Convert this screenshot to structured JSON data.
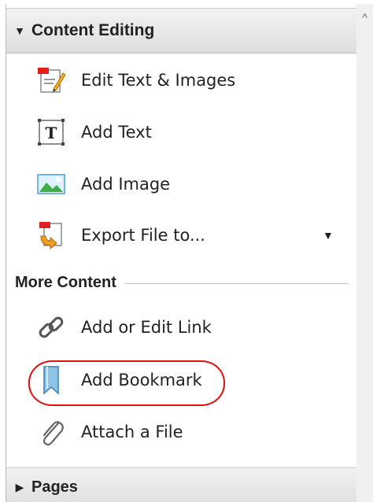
{
  "panel": {
    "content_editing": {
      "title": "Content Editing",
      "items": [
        {
          "label": "Edit Text & Images",
          "icon": "edit-text-images-icon"
        },
        {
          "label": "Add Text",
          "icon": "add-text-icon"
        },
        {
          "label": "Add Image",
          "icon": "add-image-icon"
        },
        {
          "label": "Export File to...",
          "icon": "export-file-icon",
          "has_dropdown": true
        }
      ]
    },
    "more_content": {
      "title": "More Content",
      "items": [
        {
          "label": "Add or Edit Link",
          "icon": "link-icon"
        },
        {
          "label": "Add Bookmark",
          "icon": "bookmark-icon",
          "highlighted": true
        },
        {
          "label": "Attach a File",
          "icon": "paperclip-icon"
        }
      ]
    },
    "pages": {
      "title": "Pages"
    }
  },
  "colors": {
    "highlight": "#e01010",
    "header_bg": "#e6e6e6",
    "text": "#222222"
  }
}
